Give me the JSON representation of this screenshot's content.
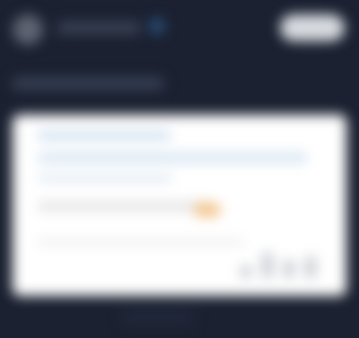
{
  "colors": {
    "background": "#1b2131",
    "panel": "#ffffff",
    "accent": "#f4c58e",
    "highlight": "#2a4e78"
  },
  "header": {
    "avatar_icon": "user-avatar-icon",
    "status_icon": "status-indicator-icon",
    "title": "",
    "action_label": ""
  },
  "subheading": "",
  "panel": {
    "line_1": "",
    "line_2": "",
    "line_3": "",
    "line_4": "",
    "line_5": "",
    "accent_label": ""
  },
  "footer": {
    "label": ""
  }
}
